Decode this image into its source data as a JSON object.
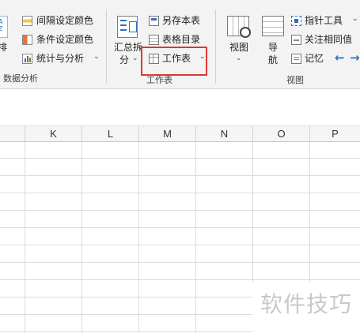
{
  "ribbon": {
    "sort_group": {
      "sort_label": "排",
      "group_label": "数据分析",
      "items": [
        {
          "label": "间隔设定颜色",
          "icon": "interval-color-icon",
          "caret": ""
        },
        {
          "label": "条件设定颜色",
          "icon": "conditional-color-icon",
          "caret": ""
        },
        {
          "label": "统计与分析",
          "icon": "statistics-icon",
          "caret": "⌄"
        }
      ]
    },
    "worksheet_group": {
      "group_label": "工作表",
      "summary_line1": "汇总拆",
      "summary_line2": "分",
      "summary_caret": "⌄",
      "items": [
        {
          "label": "另存本表",
          "icon": "save-sheet-icon",
          "caret": ""
        },
        {
          "label": "表格目录",
          "icon": "sheet-directory-icon",
          "caret": ""
        },
        {
          "label": "工作表",
          "icon": "worksheet-icon",
          "caret": "⌄"
        }
      ],
      "highlight_color": "#d93838"
    },
    "view_group": {
      "group_label": "视图",
      "view_label": "视图",
      "view_caret": "⌄",
      "nav_line1": "导",
      "nav_line2": "航",
      "items": [
        {
          "label": "指针工具",
          "icon": "pointer-tool-icon",
          "caret": "⌄"
        },
        {
          "label": "关注相同值",
          "icon": "focus-same-value-icon",
          "caret": ""
        },
        {
          "label": "记忆",
          "icon": "memory-icon",
          "caret": ""
        }
      ],
      "arrow_left": "←",
      "arrow_right": "→"
    }
  },
  "sheet": {
    "columns": [
      "K",
      "L",
      "M",
      "N",
      "O",
      "P"
    ]
  },
  "watermark": "软件技巧",
  "colors": {
    "accent_blue": "#2f6fbf",
    "highlight_red": "#d93838"
  }
}
